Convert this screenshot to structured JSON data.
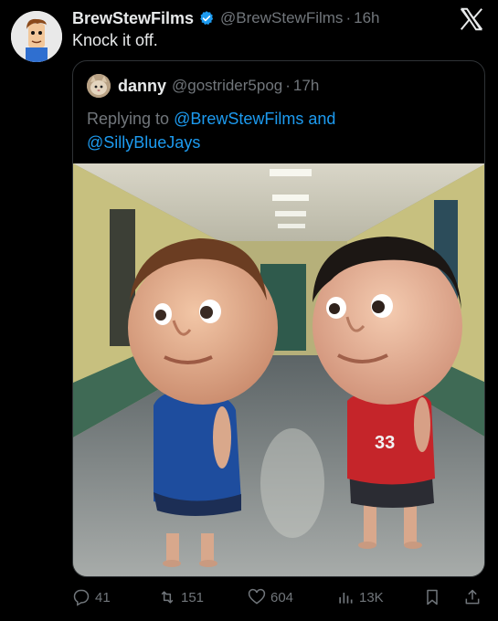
{
  "tweet": {
    "author_name": "BrewStewFilms",
    "author_handle": "@BrewStewFilms",
    "time": "16h",
    "text": "Knock it off."
  },
  "quoted": {
    "author_name": "danny",
    "author_handle": "@gostrider5pog",
    "time": "17h",
    "replying_prefix": "Replying to",
    "replying_user1": "@BrewStewFilms",
    "replying_and": "and",
    "replying_user2": "@SillyBlueJays",
    "image_jersey_number": "33"
  },
  "actions": {
    "replies": "41",
    "reposts": "151",
    "likes": "604",
    "views": "13K"
  },
  "colors": {
    "background": "#000000",
    "text": "#e7e9ea",
    "muted": "#71767b",
    "link": "#1d9bf0",
    "border": "#2f3336"
  },
  "icons": [
    "verified-badge-icon",
    "x-logo-icon",
    "reply-icon",
    "repost-icon",
    "like-icon",
    "views-icon",
    "bookmark-icon",
    "share-icon"
  ]
}
